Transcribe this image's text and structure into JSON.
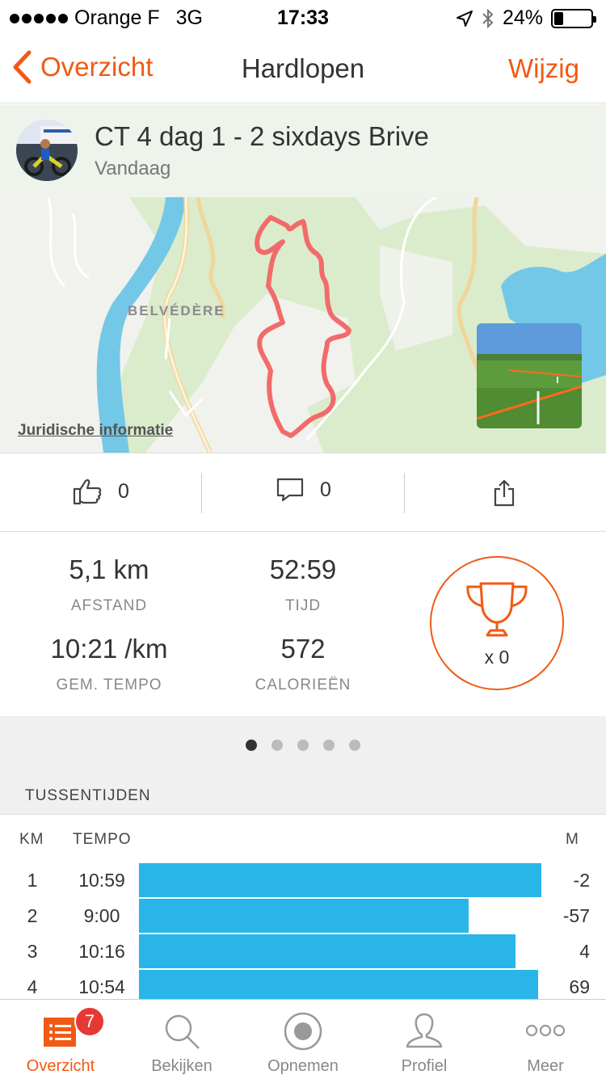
{
  "status_bar": {
    "carrier": "Orange F",
    "network": "3G",
    "time": "17:33",
    "battery": "24%",
    "battery_level": 0.24
  },
  "nav": {
    "back_label": "Overzicht",
    "title": "Hardlopen",
    "edit_label": "Wijzig"
  },
  "activity": {
    "title": "CT 4 dag 1 - 2 sixdays Brive",
    "date": "Vandaag"
  },
  "map": {
    "place_label": "BELVÉDÈRE",
    "legal_label": "Juridische informatie"
  },
  "social": {
    "likes": "0",
    "comments": "0"
  },
  "stats": {
    "distance_value": "5,1 km",
    "distance_label": "AFSTAND",
    "time_value": "52:59",
    "time_label": "TIJD",
    "pace_value": "10:21 /km",
    "pace_label": "GEM. TEMPO",
    "calories_value": "572",
    "calories_label": "CALORIEËN",
    "trophy_count": "x 0"
  },
  "pager": {
    "pages": 5,
    "active": 0
  },
  "splits": {
    "title": "TUSSENTIJDEN",
    "col_km": "KM",
    "col_tempo": "TEMPO",
    "col_m": "M",
    "rows": [
      {
        "km": "1",
        "tempo": "10:59",
        "m": "-2",
        "pace_seconds": 659
      },
      {
        "km": "2",
        "tempo": "9:00",
        "m": "-57",
        "pace_seconds": 540
      },
      {
        "km": "3",
        "tempo": "10:16",
        "m": "4",
        "pace_seconds": 616
      },
      {
        "km": "4",
        "tempo": "10:54",
        "m": "69",
        "pace_seconds": 654
      }
    ]
  },
  "tabs": [
    {
      "label": "Overzicht",
      "icon": "list-icon",
      "active": true
    },
    {
      "label": "Bekijken",
      "icon": "search-icon",
      "active": false
    },
    {
      "label": "Opnemen",
      "icon": "record-icon",
      "active": false
    },
    {
      "label": "Profiel",
      "icon": "profile-icon",
      "active": false
    },
    {
      "label": "Meer",
      "icon": "more-icon",
      "active": false
    }
  ],
  "tab_badge": "7",
  "colors": {
    "accent": "#f05a14",
    "split_bar": "#29b5e8",
    "route": "#f26b6b"
  }
}
